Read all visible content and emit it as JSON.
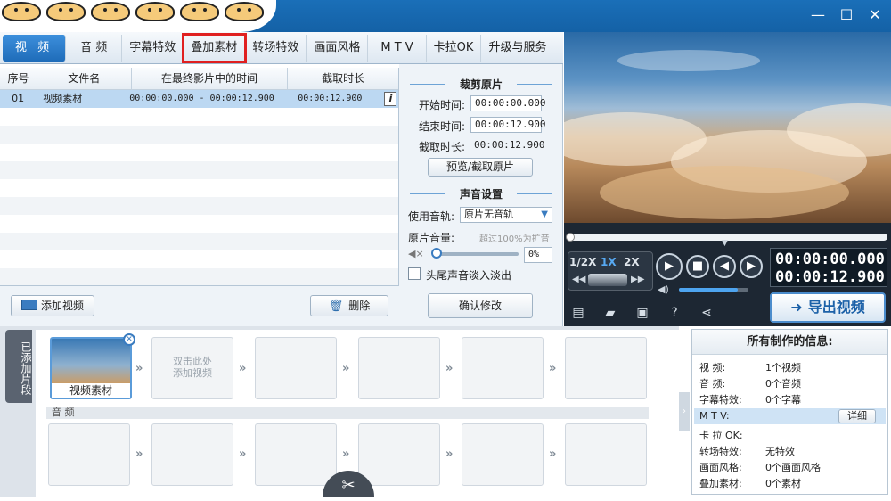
{
  "window": {
    "minimize": "—",
    "maximize": "☐",
    "close": "✕"
  },
  "tabs": [
    "视 频",
    "音 频",
    "字幕特效",
    "叠加素材",
    "转场特效",
    "画面风格",
    "M T V",
    "卡拉OK",
    "升级与服务"
  ],
  "table": {
    "headers": [
      "序号",
      "文件名",
      "在最终影片中的时间",
      "截取时长"
    ],
    "rows": [
      {
        "no": "01",
        "name": "视频素材",
        "time": "00:00:00.000 - 00:00:12.900",
        "duration": "00:00:12.900"
      }
    ]
  },
  "left_bottom": {
    "add_video": "添加视频",
    "delete": "删除"
  },
  "crop": {
    "title": "裁剪原片",
    "start_label": "开始时间:",
    "start_value": "00:00:00.000",
    "end_label": "结束时间:",
    "end_value": "00:00:12.900",
    "length_label": "截取时长:",
    "length_value": "00:00:12.900",
    "preview_button": "预览/截取原片"
  },
  "sound": {
    "title": "声音设置",
    "track_label": "使用音轨:",
    "track_value": "原片无音轨",
    "volume_label": "原片音量:",
    "volume_hint": "超过100%为扩音",
    "volume_value": "0%",
    "fade_label": "头尾声音淡入淡出",
    "confirm_button": "确认修改"
  },
  "player": {
    "speeds": [
      "1/2X",
      "1X",
      "2X"
    ],
    "time_current": "00:00:00.000",
    "time_total": "00:00:12.900",
    "volume_fraction": 0.85,
    "export_button": "导出视频"
  },
  "timeline": {
    "side_tab": "已添加片段",
    "clip_label": "视频素材",
    "empty_hint": "双击此处添加视频",
    "audio_label": "音 频"
  },
  "info": {
    "title": "所有制作的信息:",
    "rows": [
      {
        "key": "视    频:",
        "value": "1个视频"
      },
      {
        "key": "音    频:",
        "value": "0个音频"
      },
      {
        "key": "字幕特效:",
        "value": "0个字幕"
      },
      {
        "key": "M  T  V:",
        "value": ""
      },
      {
        "key": "卡 拉 OK:",
        "value": ""
      },
      {
        "key": "转场特效:",
        "value": "无特效"
      },
      {
        "key": "画面风格:",
        "value": "0个画面风格"
      },
      {
        "key": "叠加素材:",
        "value": "0个素材"
      }
    ],
    "detail_button": "详细"
  }
}
